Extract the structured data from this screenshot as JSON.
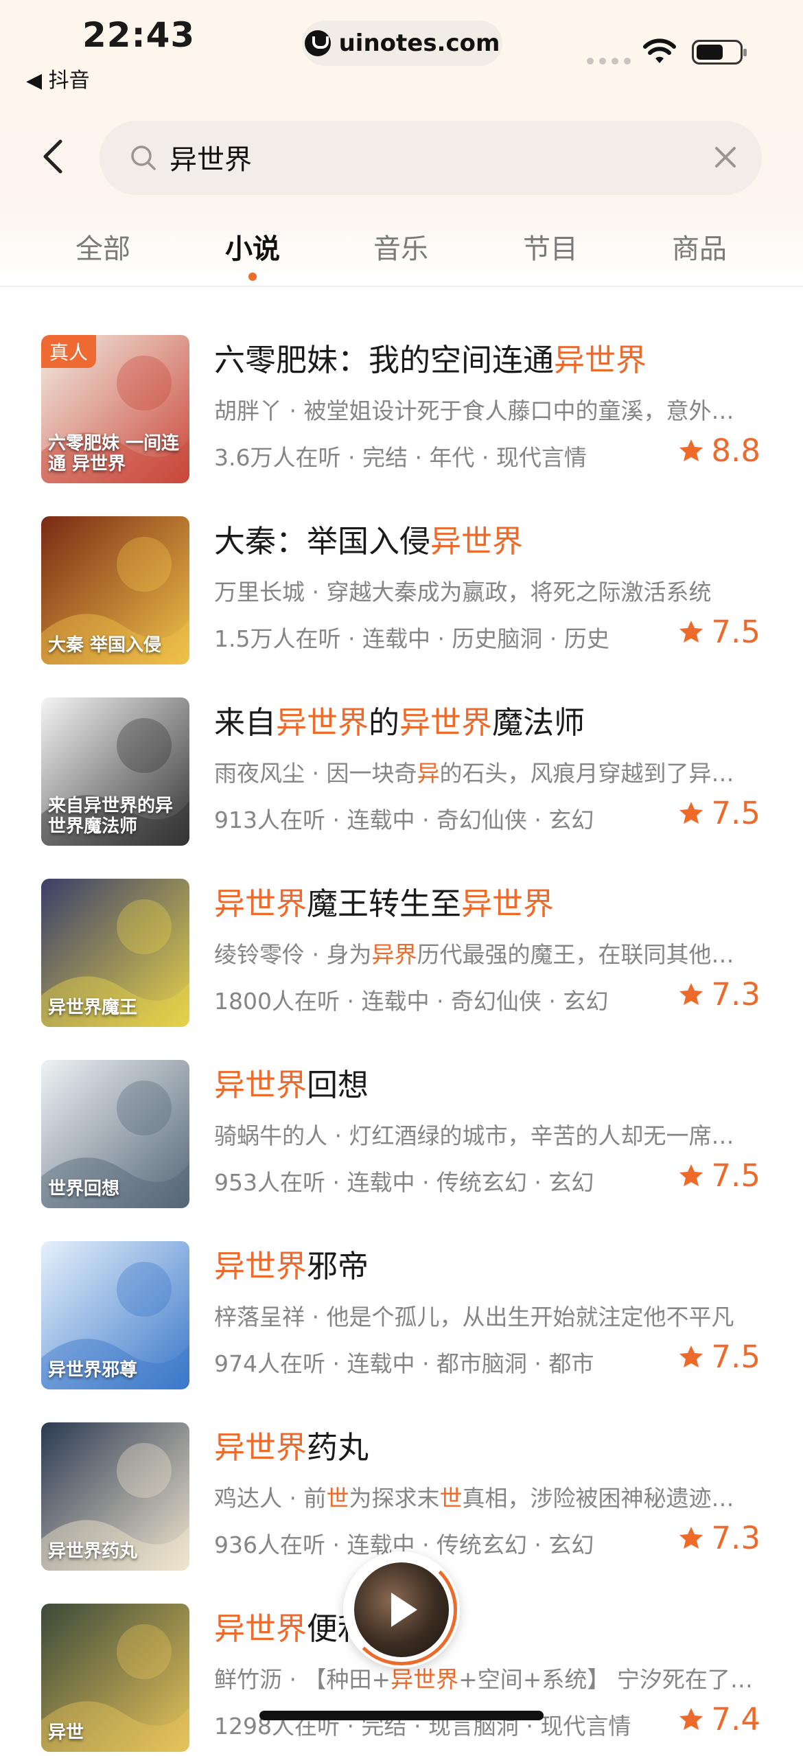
{
  "status_bar": {
    "time": "22:43",
    "back_app": "◀ 抖音",
    "url": "uinotes.com"
  },
  "search": {
    "query": "异世界"
  },
  "tabs": [
    {
      "label": "全部",
      "active": false
    },
    {
      "label": "小说",
      "active": true
    },
    {
      "label": "音乐",
      "active": false
    },
    {
      "label": "节目",
      "active": false
    },
    {
      "label": "商品",
      "active": false
    }
  ],
  "colors": {
    "accent": "#ee6a2b",
    "text_primary": "#1a1a1a",
    "text_secondary": "#858585"
  },
  "results": [
    {
      "badge": "真人",
      "title_parts": [
        {
          "t": "六零肥妹：我的空间连通",
          "h": false
        },
        {
          "t": "异世界",
          "h": true
        }
      ],
      "desc_parts": [
        {
          "t": "胡胖丫 · 被堂姐设计死于食人藤口中的童溪，意外获得空间连通异世界",
          "h": false
        }
      ],
      "meta": "3.6万人在听 · 完结 · 年代 · 现代言情",
      "score": "8.8",
      "cover_text": "六零肥妹 一间连通 异世界",
      "cover_colors": [
        "#f3ece2",
        "#c9483a"
      ]
    },
    {
      "title_parts": [
        {
          "t": "大秦：举国入侵",
          "h": false
        },
        {
          "t": "异世界",
          "h": true
        }
      ],
      "desc_parts": [
        {
          "t": "万里长城 · 穿越大秦成为嬴政，将死之际激活系统",
          "h": false
        }
      ],
      "meta": "1.5万人在听 · 连载中 · 历史脑洞 · 历史",
      "score": "7.5",
      "cover_text": "大秦 举国入侵",
      "cover_colors": [
        "#7a2a14",
        "#f0c24a"
      ]
    },
    {
      "title_parts": [
        {
          "t": "来自",
          "h": false
        },
        {
          "t": "异世界",
          "h": true
        },
        {
          "t": "的",
          "h": false
        },
        {
          "t": "异世界",
          "h": true
        },
        {
          "t": "魔法师",
          "h": false
        }
      ],
      "desc_parts": [
        {
          "t": "雨夜风尘 · 因一块奇",
          "h": false
        },
        {
          "t": "异",
          "h": true
        },
        {
          "t": "的石头，风痕月穿越到了异世界",
          "h": false
        }
      ],
      "meta": "913人在听 · 连载中 · 奇幻仙侠 · 玄幻",
      "score": "7.5",
      "cover_text": "来自异世界的异世界魔法师",
      "cover_colors": [
        "#f4f4f4",
        "#333333"
      ]
    },
    {
      "title_parts": [
        {
          "t": "异世界",
          "h": true
        },
        {
          "t": "魔王转生至",
          "h": false
        },
        {
          "t": "异世界",
          "h": true
        }
      ],
      "desc_parts": [
        {
          "t": "绫铃零伶 · 身为",
          "h": false
        },
        {
          "t": "异界",
          "h": true
        },
        {
          "t": "历代最强的魔王，在联同其他魔王",
          "h": false
        }
      ],
      "meta": "1800人在听 · 连载中 · 奇幻仙侠 · 玄幻",
      "score": "7.3",
      "cover_text": "异世界魔王",
      "cover_colors": [
        "#3a3f6a",
        "#e7d24a"
      ]
    },
    {
      "title_parts": [
        {
          "t": "异世界",
          "h": true
        },
        {
          "t": "回想",
          "h": false
        }
      ],
      "desc_parts": [
        {
          "t": "骑蜗牛的人 · 灯红酒绿的城市，辛苦的人却无一席之地",
          "h": false
        }
      ],
      "meta": "953人在听 · 连载中 · 传统玄幻 · 玄幻",
      "score": "7.5",
      "cover_text": "世界回想",
      "cover_colors": [
        "#eef2f4",
        "#556677"
      ]
    },
    {
      "title_parts": [
        {
          "t": "异世界",
          "h": true
        },
        {
          "t": "邪帝",
          "h": false
        }
      ],
      "desc_parts": [
        {
          "t": "梓落呈祥 · 他是个孤儿，从出生开始就注定他不平凡",
          "h": false
        }
      ],
      "meta": "974人在听 · 连载中 · 都市脑洞 · 都市",
      "score": "7.5",
      "cover_text": "异世界邪尊",
      "cover_colors": [
        "#e6f0fb",
        "#3b78c9"
      ]
    },
    {
      "title_parts": [
        {
          "t": "异世界",
          "h": true
        },
        {
          "t": "药丸",
          "h": false
        }
      ],
      "desc_parts": [
        {
          "t": "鸡达人 · 前",
          "h": false
        },
        {
          "t": "世",
          "h": true
        },
        {
          "t": "为探求末",
          "h": false
        },
        {
          "t": "世",
          "h": true
        },
        {
          "t": "真相，涉险被困神秘遗迹之中",
          "h": false
        }
      ],
      "meta": "936人在听 · 连载中 · 传统玄幻 · 玄幻",
      "score": "7.3",
      "cover_text": "异世界药丸",
      "cover_colors": [
        "#2b3a52",
        "#f1e6cf"
      ]
    },
    {
      "title_parts": [
        {
          "t": "异世界",
          "h": true
        },
        {
          "t": "便利",
          "h": false
        }
      ],
      "desc_parts": [
        {
          "t": "鲜竹沥 · 【种田+",
          "h": false
        },
        {
          "t": "异世界",
          "h": true
        },
        {
          "t": "+空间+系统】 宁汐死在了末世之中",
          "h": false
        }
      ],
      "meta": "1298人在听 · 完结 · 现言脑洞 · 现代言情",
      "score": "7.4",
      "cover_text": "异世",
      "cover_colors": [
        "#3b4a3a",
        "#e7c35a"
      ]
    }
  ]
}
